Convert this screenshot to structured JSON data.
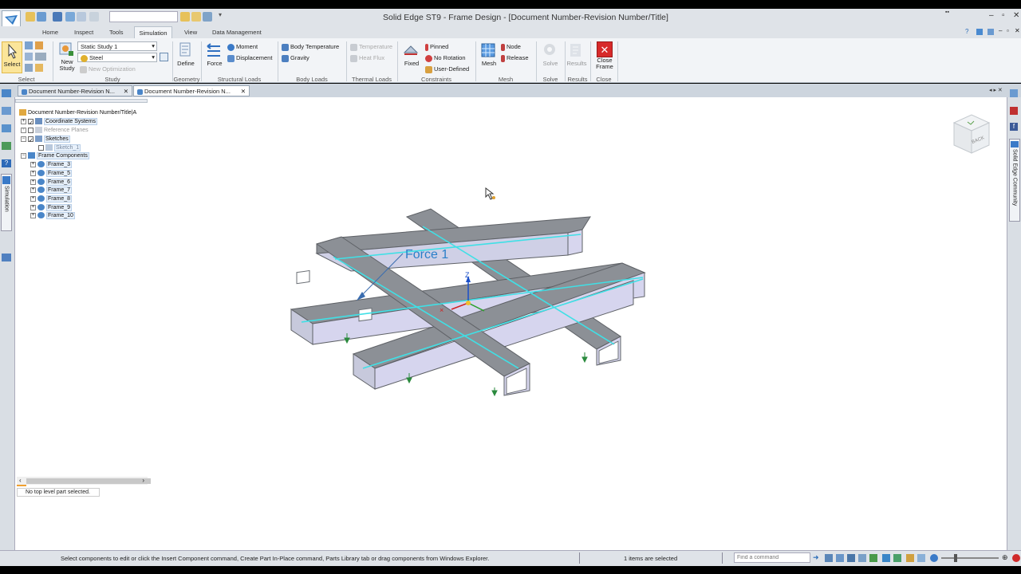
{
  "window": {
    "title": "Solid Edge ST9 - Frame Design - [Document Number-Revision Number/Title]"
  },
  "ribbon_tabs": [
    "Home",
    "Inspect",
    "Tools",
    "Simulation",
    "View",
    "Data Management"
  ],
  "ribbon": {
    "select": {
      "button": "Select",
      "group": "Select"
    },
    "study": {
      "study_value": "Static Study 1",
      "material_value": "Steel",
      "new_study": "New",
      "new_study2": "Study",
      "new_optimization": "New Optimization",
      "group": "Study"
    },
    "geometry": {
      "define": "Define",
      "group": "Geometry"
    },
    "structural_loads": {
      "force": "Force",
      "moment": "Moment",
      "displacement": "Displacement",
      "group": "Structural Loads"
    },
    "body_loads": {
      "body_temperature": "Body Temperature",
      "gravity": "Gravity",
      "group": "Body Loads"
    },
    "thermal_loads": {
      "temperature": "Temperature",
      "heat_flux": "Heat Flux",
      "group": "Thermal Loads"
    },
    "constraints": {
      "fixed": "Fixed",
      "pinned": "Pinned",
      "no_rotation": "No Rotation",
      "user_defined": "User-Defined",
      "group": "Constraints"
    },
    "mesh": {
      "mesh": "Mesh",
      "node": "Node",
      "release": "Release",
      "group": "Mesh"
    },
    "solve": {
      "solve": "Solve",
      "group": "Solve"
    },
    "results": {
      "results": "Results",
      "group": "Results"
    },
    "close": {
      "close_line1": "Close",
      "close_line2": "Frame",
      "group": "Close"
    }
  },
  "doc_tabs": [
    "Document Number-Revision N...",
    "Document Number-Revision N..."
  ],
  "left_strip": {
    "simulation": "Simulation"
  },
  "right_strip": {
    "community": "Solid Edge Community"
  },
  "tree": {
    "root": "Document Number-Revision Number/Title|A",
    "items": [
      {
        "label": "Coordinate Systems"
      },
      {
        "label": "Reference Planes"
      },
      {
        "label": "Sketches"
      },
      {
        "label": "Sketch_1"
      },
      {
        "label": "Frame Components"
      },
      {
        "label": "Frame_3"
      },
      {
        "label": "Frame_5"
      },
      {
        "label": "Frame_6"
      },
      {
        "label": "Frame_7"
      },
      {
        "label": "Frame_8"
      },
      {
        "label": "Frame_9"
      },
      {
        "label": "Frame_10"
      }
    ],
    "status_message": "No top level part selected."
  },
  "viewport": {
    "force_label": "Force 1",
    "axis_z": "Z",
    "view_cube_label": "BACK"
  },
  "statusbar": {
    "prompt": "Select components to edit or click the Insert Component command, Create Part In-Place command, Parts Library tab or drag components from Windows Explorer.",
    "selection": "1 items are selected",
    "find_placeholder": "Find a command"
  },
  "colors": {
    "ribbon_bg": "#f2f4f7",
    "beam_top": "#8a8e94",
    "beam_side": "#d6d6ec",
    "beam_edge": "#3fe0e6",
    "force_text": "#2a7fc9",
    "close_red": "#d72a2a"
  }
}
